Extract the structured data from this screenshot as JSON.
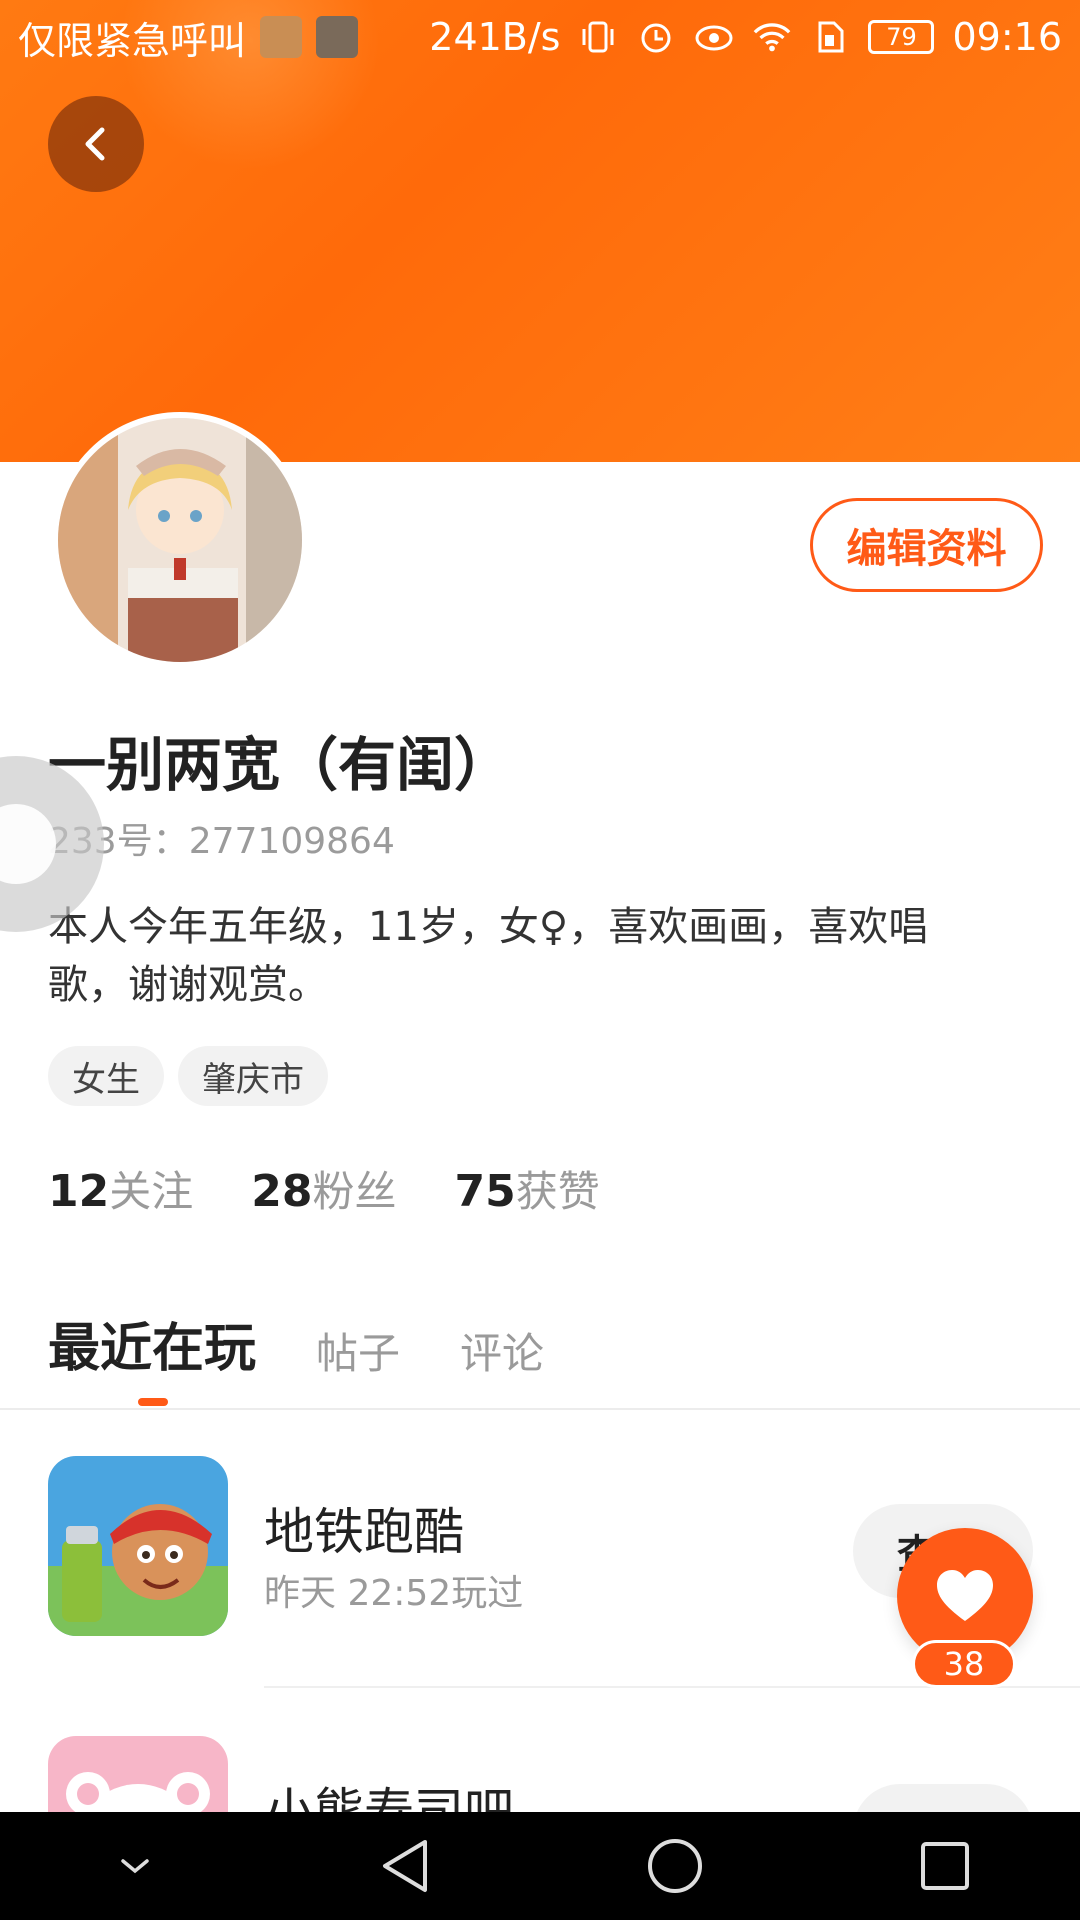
{
  "status_bar": {
    "left_text": "仅限紧急呼叫",
    "net_speed": "241B/s",
    "battery": "79",
    "time": "09:16"
  },
  "profile": {
    "edit_button_label": "编辑资料",
    "name": "一别两宽（有闺）",
    "id_text": "233号：277109864",
    "bio": "本人今年五年级，11岁，女♀，喜欢画画，喜欢唱歌，谢谢观赏。",
    "tags": [
      "女生",
      "肇庆市"
    ],
    "stats": [
      {
        "value": "12",
        "label": "关注"
      },
      {
        "value": "28",
        "label": "粉丝"
      },
      {
        "value": "75",
        "label": "获赞"
      }
    ]
  },
  "tabs": [
    {
      "label": "最近在玩",
      "active": true
    },
    {
      "label": "帖子",
      "active": false
    },
    {
      "label": "评论",
      "active": false
    }
  ],
  "recent_games": [
    {
      "title": "地铁跑酷",
      "subtitle": "昨天 22:52玩过",
      "button_label": "查"
    },
    {
      "title": "小熊寿司吧",
      "subtitle": "",
      "button_label": ""
    }
  ],
  "like": {
    "count": "38"
  },
  "colors": {
    "accent": "#ff5a17",
    "header": "#ff7a12"
  },
  "icons": {
    "back": "chevron-left-icon",
    "like": "heart-icon",
    "nav_down": "chevron-down-icon",
    "nav_back": "triangle-back-icon",
    "nav_home": "circle-home-icon",
    "nav_recent": "square-recent-icon"
  }
}
